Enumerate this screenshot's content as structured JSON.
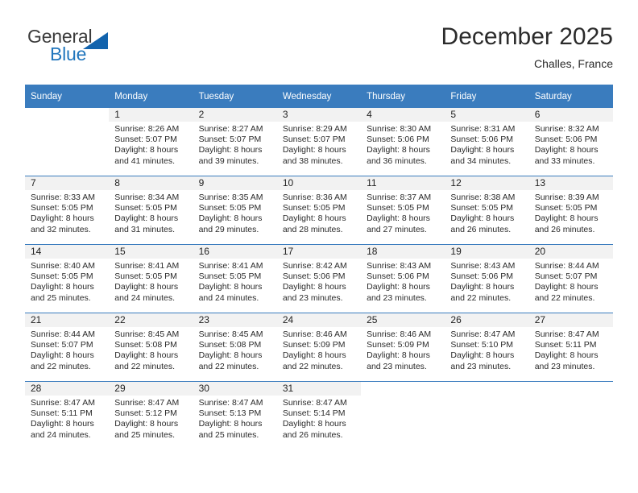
{
  "brand": {
    "word1": "General",
    "word2": "Blue",
    "logo_icon": "triangle-icon",
    "color_primary": "#1263ad",
    "color_text": "#3b3b3b"
  },
  "header": {
    "month_title": "December 2025",
    "location": "Challes, France"
  },
  "theme": {
    "header_bg": "#3a7cbe",
    "daynum_bg": "#f2f2f2",
    "row_border": "#3a7cbe"
  },
  "weekdays": [
    "Sunday",
    "Monday",
    "Tuesday",
    "Wednesday",
    "Thursday",
    "Friday",
    "Saturday"
  ],
  "labels": {
    "sunrise_prefix": "Sunrise:",
    "sunset_prefix": "Sunset:",
    "daylight_prefix": "Daylight:"
  },
  "weeks": [
    [
      {
        "day": "",
        "sunrise": "",
        "sunset": "",
        "daylight": ""
      },
      {
        "day": "1",
        "sunrise": "Sunrise: 8:26 AM",
        "sunset": "Sunset: 5:07 PM",
        "daylight": "Daylight: 8 hours and 41 minutes."
      },
      {
        "day": "2",
        "sunrise": "Sunrise: 8:27 AM",
        "sunset": "Sunset: 5:07 PM",
        "daylight": "Daylight: 8 hours and 39 minutes."
      },
      {
        "day": "3",
        "sunrise": "Sunrise: 8:29 AM",
        "sunset": "Sunset: 5:07 PM",
        "daylight": "Daylight: 8 hours and 38 minutes."
      },
      {
        "day": "4",
        "sunrise": "Sunrise: 8:30 AM",
        "sunset": "Sunset: 5:06 PM",
        "daylight": "Daylight: 8 hours and 36 minutes."
      },
      {
        "day": "5",
        "sunrise": "Sunrise: 8:31 AM",
        "sunset": "Sunset: 5:06 PM",
        "daylight": "Daylight: 8 hours and 34 minutes."
      },
      {
        "day": "6",
        "sunrise": "Sunrise: 8:32 AM",
        "sunset": "Sunset: 5:06 PM",
        "daylight": "Daylight: 8 hours and 33 minutes."
      }
    ],
    [
      {
        "day": "7",
        "sunrise": "Sunrise: 8:33 AM",
        "sunset": "Sunset: 5:05 PM",
        "daylight": "Daylight: 8 hours and 32 minutes."
      },
      {
        "day": "8",
        "sunrise": "Sunrise: 8:34 AM",
        "sunset": "Sunset: 5:05 PM",
        "daylight": "Daylight: 8 hours and 31 minutes."
      },
      {
        "day": "9",
        "sunrise": "Sunrise: 8:35 AM",
        "sunset": "Sunset: 5:05 PM",
        "daylight": "Daylight: 8 hours and 29 minutes."
      },
      {
        "day": "10",
        "sunrise": "Sunrise: 8:36 AM",
        "sunset": "Sunset: 5:05 PM",
        "daylight": "Daylight: 8 hours and 28 minutes."
      },
      {
        "day": "11",
        "sunrise": "Sunrise: 8:37 AM",
        "sunset": "Sunset: 5:05 PM",
        "daylight": "Daylight: 8 hours and 27 minutes."
      },
      {
        "day": "12",
        "sunrise": "Sunrise: 8:38 AM",
        "sunset": "Sunset: 5:05 PM",
        "daylight": "Daylight: 8 hours and 26 minutes."
      },
      {
        "day": "13",
        "sunrise": "Sunrise: 8:39 AM",
        "sunset": "Sunset: 5:05 PM",
        "daylight": "Daylight: 8 hours and 26 minutes."
      }
    ],
    [
      {
        "day": "14",
        "sunrise": "Sunrise: 8:40 AM",
        "sunset": "Sunset: 5:05 PM",
        "daylight": "Daylight: 8 hours and 25 minutes."
      },
      {
        "day": "15",
        "sunrise": "Sunrise: 8:41 AM",
        "sunset": "Sunset: 5:05 PM",
        "daylight": "Daylight: 8 hours and 24 minutes."
      },
      {
        "day": "16",
        "sunrise": "Sunrise: 8:41 AM",
        "sunset": "Sunset: 5:05 PM",
        "daylight": "Daylight: 8 hours and 24 minutes."
      },
      {
        "day": "17",
        "sunrise": "Sunrise: 8:42 AM",
        "sunset": "Sunset: 5:06 PM",
        "daylight": "Daylight: 8 hours and 23 minutes."
      },
      {
        "day": "18",
        "sunrise": "Sunrise: 8:43 AM",
        "sunset": "Sunset: 5:06 PM",
        "daylight": "Daylight: 8 hours and 23 minutes."
      },
      {
        "day": "19",
        "sunrise": "Sunrise: 8:43 AM",
        "sunset": "Sunset: 5:06 PM",
        "daylight": "Daylight: 8 hours and 22 minutes."
      },
      {
        "day": "20",
        "sunrise": "Sunrise: 8:44 AM",
        "sunset": "Sunset: 5:07 PM",
        "daylight": "Daylight: 8 hours and 22 minutes."
      }
    ],
    [
      {
        "day": "21",
        "sunrise": "Sunrise: 8:44 AM",
        "sunset": "Sunset: 5:07 PM",
        "daylight": "Daylight: 8 hours and 22 minutes."
      },
      {
        "day": "22",
        "sunrise": "Sunrise: 8:45 AM",
        "sunset": "Sunset: 5:08 PM",
        "daylight": "Daylight: 8 hours and 22 minutes."
      },
      {
        "day": "23",
        "sunrise": "Sunrise: 8:45 AM",
        "sunset": "Sunset: 5:08 PM",
        "daylight": "Daylight: 8 hours and 22 minutes."
      },
      {
        "day": "24",
        "sunrise": "Sunrise: 8:46 AM",
        "sunset": "Sunset: 5:09 PM",
        "daylight": "Daylight: 8 hours and 22 minutes."
      },
      {
        "day": "25",
        "sunrise": "Sunrise: 8:46 AM",
        "sunset": "Sunset: 5:09 PM",
        "daylight": "Daylight: 8 hours and 23 minutes."
      },
      {
        "day": "26",
        "sunrise": "Sunrise: 8:47 AM",
        "sunset": "Sunset: 5:10 PM",
        "daylight": "Daylight: 8 hours and 23 minutes."
      },
      {
        "day": "27",
        "sunrise": "Sunrise: 8:47 AM",
        "sunset": "Sunset: 5:11 PM",
        "daylight": "Daylight: 8 hours and 23 minutes."
      }
    ],
    [
      {
        "day": "28",
        "sunrise": "Sunrise: 8:47 AM",
        "sunset": "Sunset: 5:11 PM",
        "daylight": "Daylight: 8 hours and 24 minutes."
      },
      {
        "day": "29",
        "sunrise": "Sunrise: 8:47 AM",
        "sunset": "Sunset: 5:12 PM",
        "daylight": "Daylight: 8 hours and 25 minutes."
      },
      {
        "day": "30",
        "sunrise": "Sunrise: 8:47 AM",
        "sunset": "Sunset: 5:13 PM",
        "daylight": "Daylight: 8 hours and 25 minutes."
      },
      {
        "day": "31",
        "sunrise": "Sunrise: 8:47 AM",
        "sunset": "Sunset: 5:14 PM",
        "daylight": "Daylight: 8 hours and 26 minutes."
      },
      {
        "day": "",
        "sunrise": "",
        "sunset": "",
        "daylight": ""
      },
      {
        "day": "",
        "sunrise": "",
        "sunset": "",
        "daylight": ""
      },
      {
        "day": "",
        "sunrise": "",
        "sunset": "",
        "daylight": ""
      }
    ]
  ]
}
